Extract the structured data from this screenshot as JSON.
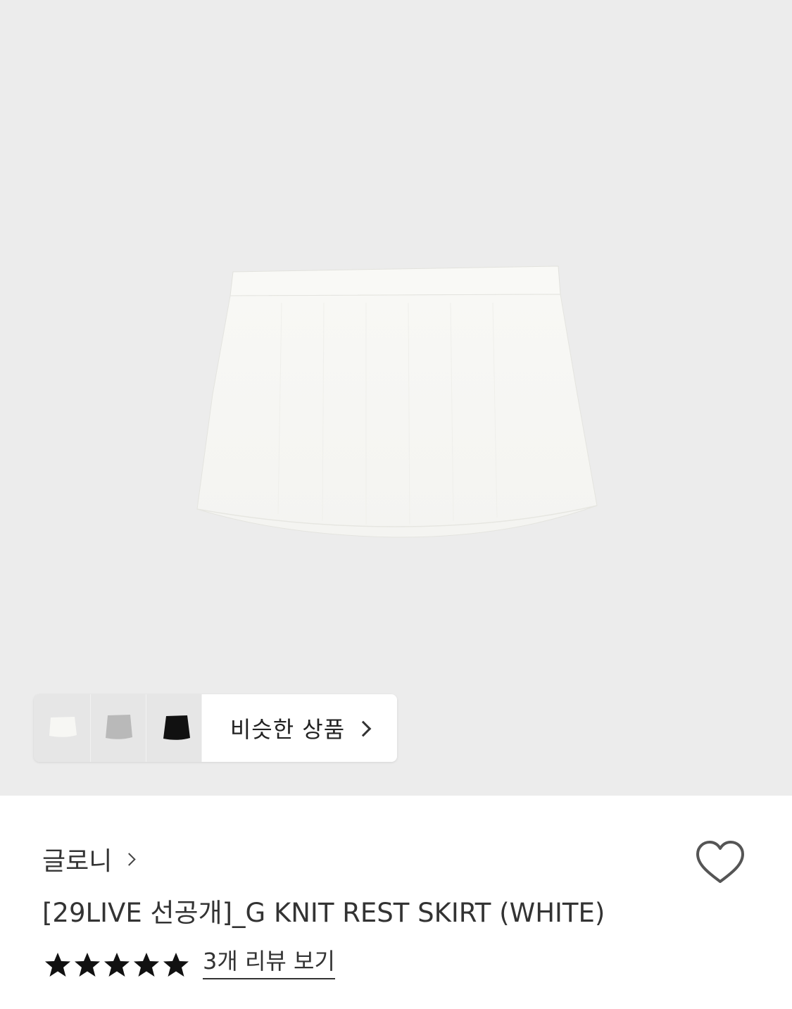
{
  "product": {
    "brand": "글로니",
    "title": "[29LIVE 선공개]_G KNIT REST SKIRT (WHITE)",
    "rating_stars": 5,
    "review_link": "3개 리뷰 보기",
    "wishlisted": false
  },
  "similar": {
    "label": "비슷한 상품",
    "thumbnails": [
      {
        "color_name": "white",
        "color": "#f7f7f4"
      },
      {
        "color_name": "gray",
        "color": "#b9b9b9"
      },
      {
        "color_name": "black",
        "color": "#111111"
      }
    ]
  },
  "colors": {
    "hero_bg": "#ececec",
    "skirt": "#f7f7f4"
  }
}
